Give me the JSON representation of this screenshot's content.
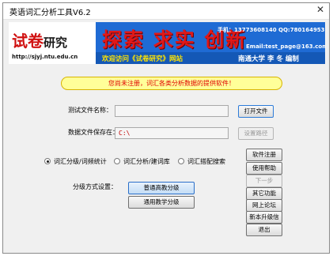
{
  "window": {
    "title": "英语词汇分析工具V6.2",
    "close_glyph": "✕"
  },
  "banner": {
    "logo_main": "试卷",
    "logo_sub": "研究",
    "url": "http://sjyj.ntu.edu.cn",
    "slogan": "探索 求实 创新",
    "phone": "手机：13773608140  QQ:780164953",
    "email": "Email:test_page@163.com",
    "welcome": "欢迎访问《试卷研究》网站",
    "editor": "南通大学 李 冬 编制"
  },
  "notice": "您尚未注册，词汇各类分析数据的提供软件！",
  "test_file": {
    "label": "测试文件名称：",
    "value": "",
    "open_button": "打开文件"
  },
  "data_save": {
    "label": "数据文件保存在：",
    "value": "C:\\",
    "path_button": "设置路径"
  },
  "modes": [
    {
      "label": "词汇分级/词频统计",
      "selected": true
    },
    {
      "label": "词汇分析/建词库",
      "selected": false
    },
    {
      "label": "词汇搭配搜索",
      "selected": false
    }
  ],
  "grading": {
    "label": "分级方式设置：",
    "btn_advanced": "普通高教分级",
    "btn_general": "通用教学分级"
  },
  "side_buttons": {
    "register": "软件注册",
    "help": "使用帮助",
    "next": "下一步",
    "other": "其它功能",
    "forum": "网上论坛",
    "upgrade": "新本升级信息",
    "exit": "退出"
  },
  "colors": {
    "accent": "#1f6bd4",
    "notice_bg": "#ffff99",
    "notice_text": "#e00000"
  }
}
